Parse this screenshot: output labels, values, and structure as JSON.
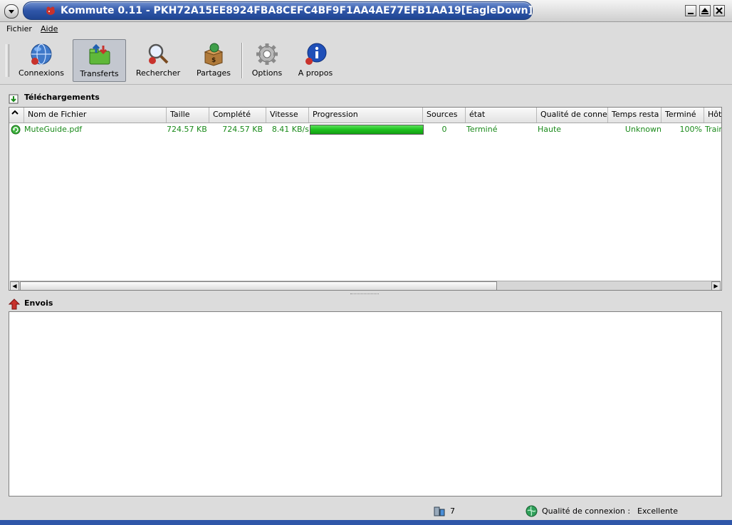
{
  "window": {
    "title": "Kommute 0.11 - PKH72A15EE8924FBA8CEFC4BF9F1AA4AE77EFB1AA19[EagleDown]",
    "accent_color": "#2f56a8"
  },
  "menu": {
    "file": "Fichier",
    "help": "Aide"
  },
  "toolbar": {
    "items": [
      {
        "label": "Connexions",
        "icon": "globe-icon"
      },
      {
        "label": "Transferts",
        "icon": "folder-transfer-icon",
        "active": true
      },
      {
        "label": "Rechercher",
        "icon": "magnifier-icon"
      },
      {
        "label": "Partages",
        "icon": "shared-box-icon"
      },
      {
        "label": "Options",
        "icon": "gear-icon"
      },
      {
        "label": "A propos",
        "icon": "info-icon"
      }
    ]
  },
  "downloads": {
    "title": "Téléchargements",
    "columns": [
      "Nom de Fichier",
      "Taille",
      "Complété",
      "Vitesse",
      "Progression",
      "Sources",
      "état",
      "Qualité de conne",
      "Temps resta",
      "Terminé",
      "Hôt"
    ],
    "rows": [
      {
        "name": "MuteGuide.pdf",
        "size": "724.57 KB",
        "completed": "724.57 KB",
        "speed": "8.41 KB/s",
        "progress": 1.0,
        "sources": "0",
        "state": "Terminé",
        "quality": "Haute",
        "remaining": "Unknown",
        "finished": "100%",
        "host": "Trair",
        "text_color": "#1a8a1a"
      }
    ]
  },
  "uploads": {
    "title": "Envois"
  },
  "status": {
    "peers": "7",
    "quality_label": "Qualité de connexion :",
    "quality_value": "Excellente"
  }
}
